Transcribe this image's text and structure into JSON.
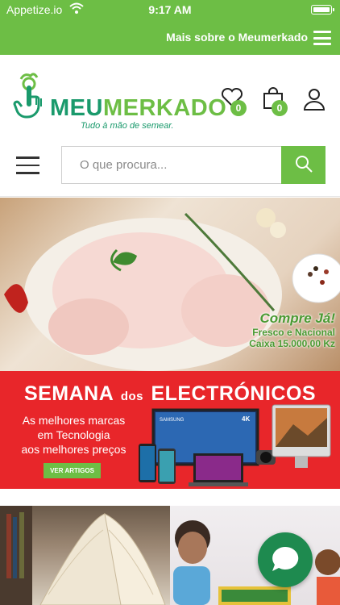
{
  "status_bar": {
    "carrier": "Appetize.io",
    "time": "9:17 AM"
  },
  "top_bar": {
    "more_label": "Mais sobre o Meumerkado"
  },
  "header": {
    "logo_part1": "MEU",
    "logo_part2": "MERKADO",
    "tagline": "Tudo à mão de semear.",
    "favorites_count": "0",
    "cart_count": "0"
  },
  "search": {
    "placeholder": "O que procura..."
  },
  "banner_chicken": {
    "title": "Compre Já!",
    "line1": "Fresco e Nacional",
    "line2": "Caixa 15.000,00 Kz"
  },
  "banner_electronics": {
    "title_part1": "SEMANA",
    "title_part2": "dos",
    "title_part3": "ELECTRÓNICOS",
    "subtitle_line1": "As melhores marcas",
    "subtitle_line2": "em Tecnologia",
    "subtitle_line3": "aos melhores preços",
    "button_label": "VER ARTIGOS",
    "tv_brand": "SAMSUNG",
    "tv_badge": "4K"
  },
  "colors": {
    "brand_green": "#6dbe45",
    "brand_dark_green": "#1a9a6c",
    "electronics_red": "#e8262a",
    "chat_green": "#1e8a4f"
  },
  "icons": [
    "wifi-icon",
    "battery-icon",
    "menu-icon",
    "heart-icon",
    "shopping-bag-icon",
    "user-icon",
    "hamburger-icon",
    "search-icon",
    "chat-icon"
  ]
}
